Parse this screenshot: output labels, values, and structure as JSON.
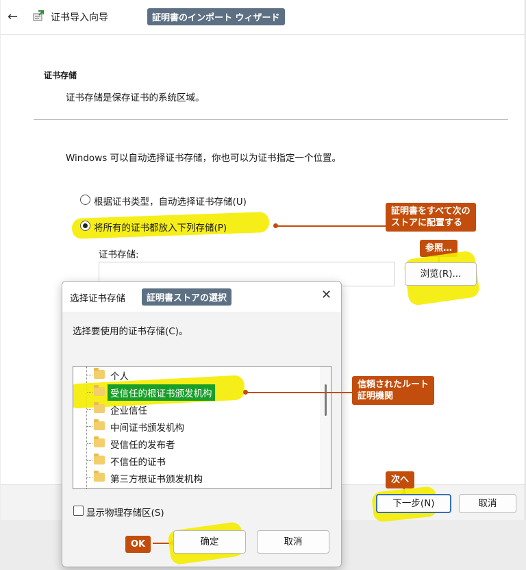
{
  "wizard": {
    "title": "证书导入向导",
    "title_tag": "証明書のインポート ウィザード",
    "section_heading": "证书存储",
    "section_desc": "证书存储是保存证书的系统区域。",
    "intro": "Windows 可以自动选择证书存储，你也可以为证书指定一个位置。",
    "option_auto": "根据证书类型，自动选择证书存储(U)",
    "option_manual": "将所有的证书都放入下列存储(P)",
    "store_label": "证书存储:",
    "store_value": "",
    "browse_button": "浏览(R)...",
    "next_button": "下一步(N)",
    "cancel_button": "取消"
  },
  "dialog": {
    "title": "选择证书存储",
    "title_tag": "証明書ストアの選択",
    "prompt": "选择要使用的证书存储(C)。",
    "stores": [
      "个人",
      "受信任的根证书颁发机构",
      "企业信任",
      "中间证书颁发机构",
      "受信任的发布者",
      "不信任的证书",
      "第三方根证书颁发机构"
    ],
    "selected_index": 1,
    "show_physical_label": "显示物理存储区(S)",
    "show_physical_checked": false,
    "ok_button": "确定",
    "cancel_button": "取消"
  },
  "annotations": {
    "place_all": "証明書をすべて次の\nストアに配置する",
    "browse": "参照…",
    "trusted_root": "信頼されたルート\n証明機関",
    "next": "次へ",
    "ok": "OK"
  },
  "colors": {
    "callout": "#c24d0c",
    "tag": "#5d7083",
    "highlight": "#f5ec00",
    "selected_row": "#1a9e2a"
  }
}
